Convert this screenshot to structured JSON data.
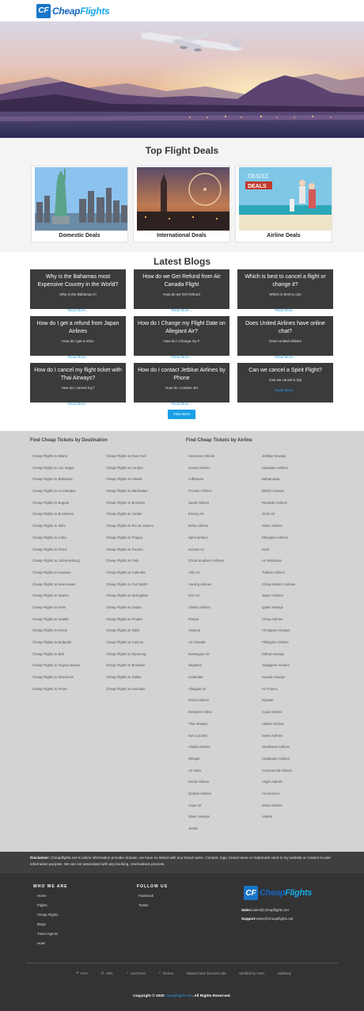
{
  "header": {
    "logo_badge": "CF",
    "logo_text_a": "Cheap",
    "logo_text_b": "Flights"
  },
  "deals": {
    "title": "Top Flight Deals",
    "cards": [
      {
        "label": "Domestic Deals"
      },
      {
        "label": "International Deals"
      },
      {
        "label": "Airline Deals",
        "image_text_1": "TRAVEL",
        "image_text_2": "DEALS"
      }
    ]
  },
  "blogs": {
    "title": "Latest Blogs",
    "read_more": "Read More...",
    "view_more": "View More",
    "cards": [
      {
        "title": "Why is the Bahamas most Expensive Country in the World?",
        "sub": "Why is the Bahamas m"
      },
      {
        "title": "How do we Get Refund from Air Canada Flight",
        "sub": "How do we Get Refund"
      },
      {
        "title": "Which is best to cancel a flight or change it?",
        "sub": "Which is best to can"
      },
      {
        "title": "How do I get a refund from Japan Airlines",
        "sub": "How do I get a refun"
      },
      {
        "title": "How do I Change my Flight Date on Allegiant Air?",
        "sub": "How do I Change my F"
      },
      {
        "title": "Does United Airlines have online chat?",
        "sub": "Does United Airlines"
      },
      {
        "title": "How do I cancel my flight ticket with Thai Airways?",
        "sub": "How do I cancel my f"
      },
      {
        "title": "How do I contact Jetblue Airlines by Phone",
        "sub": "How do I contact Jet"
      },
      {
        "title": "Can we cancel a Spirit Flight?",
        "sub": "Can we cancel a Spi"
      }
    ]
  },
  "links": {
    "destination_heading": "Find Cheap Tickets by Destination",
    "airline_heading": "Find Cheap Tickets by Airline",
    "dest_col1": [
      "Cheap Flights to Miami",
      "Cheap Flights to Las Vegas",
      "Cheap Flights to Bahamas",
      "Cheap Flights to Accelerates",
      "Cheap Flights to Bogota",
      "Cheap Flights to Bucharest",
      "Cheap Flights to delhi",
      "Cheap Flights to Cuba",
      "Cheap Flights to Peros",
      "Cheap Flights to Johannesburg",
      "Cheap Flights to Houston",
      "Cheap Flights to New Haven",
      "Cheap Flights to Sparks",
      "Cheap Flights to Paris",
      "Cheap Flights to Seattle",
      "Cheap Flights to lemon",
      "Cheap Flights to Belgrade",
      "Cheap Flights to Bali",
      "Cheap Flights to Virginia Beach",
      "Cheap Flights to Wisconsin",
      "Cheap Flights to Texas"
    ],
    "dest_col2": [
      "Cheap Flights to New York",
      "Cheap Flights to London",
      "Cheap Flights to Hawaii",
      "Cheap Flights to Manhattan",
      "Cheap Flights to Brooklyn",
      "Cheap Flights to Jordan",
      "Cheap Flights to Rio de Janeiro",
      "Cheap Flights to Prague",
      "Cheap Flights to Toronto",
      "Cheap Flights to Oslo",
      "Cheap Flights to Calendar",
      "Cheap Flights to Fort Worth",
      "Cheap Flights to Springdale",
      "Cheap Flights to Osaka",
      "Cheap Flights to Phuket",
      "Cheap Flights to Tahiti",
      "Cheap Flights to Cancun",
      "Cheap Flights to Wyoming",
      "Cheap Flights to Brisbane",
      "Cheap Flights to Dallas",
      "Cheap Flights to Honolulu"
    ],
    "air_col1": [
      "American Airlines",
      "United Airlines",
      "Lufthansa",
      "Frontier Airlines",
      "Saudi Airlines",
      "Emirey Air",
      "Delta Airlines",
      "Spirit airlines",
      "Korean Air",
      "China Southern Airlines",
      "Alitz Air",
      "Vueling Airlines",
      "EVA Air",
      "Alaska Airlines",
      "Finnair",
      "Avianca",
      "Air Canada",
      "Norwegian Air",
      "SkyWest",
      "Icelandair",
      "Allegiant Air",
      "Scoot Airlines",
      "Emirates Airline",
      "Thai Airways",
      "Sun Country",
      "Alitalia Airlines",
      "Wingair",
      "Air India",
      "Kenia Airlines",
      "Qantas Airlines",
      "Cape Air",
      "Silver Airways",
      "Jetstic"
    ],
    "air_col2": [
      "JetBlue Airways",
      "Hawaiian Airlines",
      "Bahamasair",
      "British Airways",
      "Republic Airlines",
      "Orion Air",
      "Silver Airlines",
      "Ethiopian Airlines",
      "KLM",
      "Air Moldovan",
      "Turkish Airlines",
      "China Eastern Airlines",
      "Japan Airlines",
      "Qatar Airways",
      "China Airlines",
      "All Nippon Airways",
      "Philippine Airlines",
      "Etihad Airways",
      "Singapore Airlines",
      "Kuwait Airways",
      "Air France",
      "Ryanair",
      "Copa Airlines",
      "Aliasia Airlines",
      "Swiss Airlines",
      "Southwest Airlines",
      "Caribbean Airlines",
      "Commercial Airlines",
      "Virgin Atlantic",
      "Aeromexico",
      "Mesa Airlines",
      "Volaris"
    ]
  },
  "disclaimer": {
    "label": "Disclaimer:",
    "text": "Cheapflights.net is online information provider domain, we have no linked with any brand name. Content, logo, brand name or trademark used in my website or content is user information purpose. We are not associated with any booking, reservations process."
  },
  "footer": {
    "who_heading": "WHO WE ARE",
    "who_items": [
      "Home",
      "Flights",
      "Cheap Flights",
      "Blogs",
      "Travel Agents",
      "Hotel"
    ],
    "follow_heading": "FOLLOW US",
    "follow_items": [
      "Facebook",
      "Twitter"
    ],
    "sales_label": "Sales:",
    "sales_email": "sales@cheapflights.net",
    "support_label": "Support:",
    "support_email": "sales@cheapflights.net",
    "badges": [
      "IATA",
      "ARC",
      "GeoTrust",
      "Norton",
      "MasterCard SecureCode",
      "Verified by VISA",
      "SafeKey"
    ],
    "copyright_a": "Copyright © 2020",
    "copyright_site": "cheapflights.net",
    "copyright_b": ". All Rights Reserved."
  }
}
